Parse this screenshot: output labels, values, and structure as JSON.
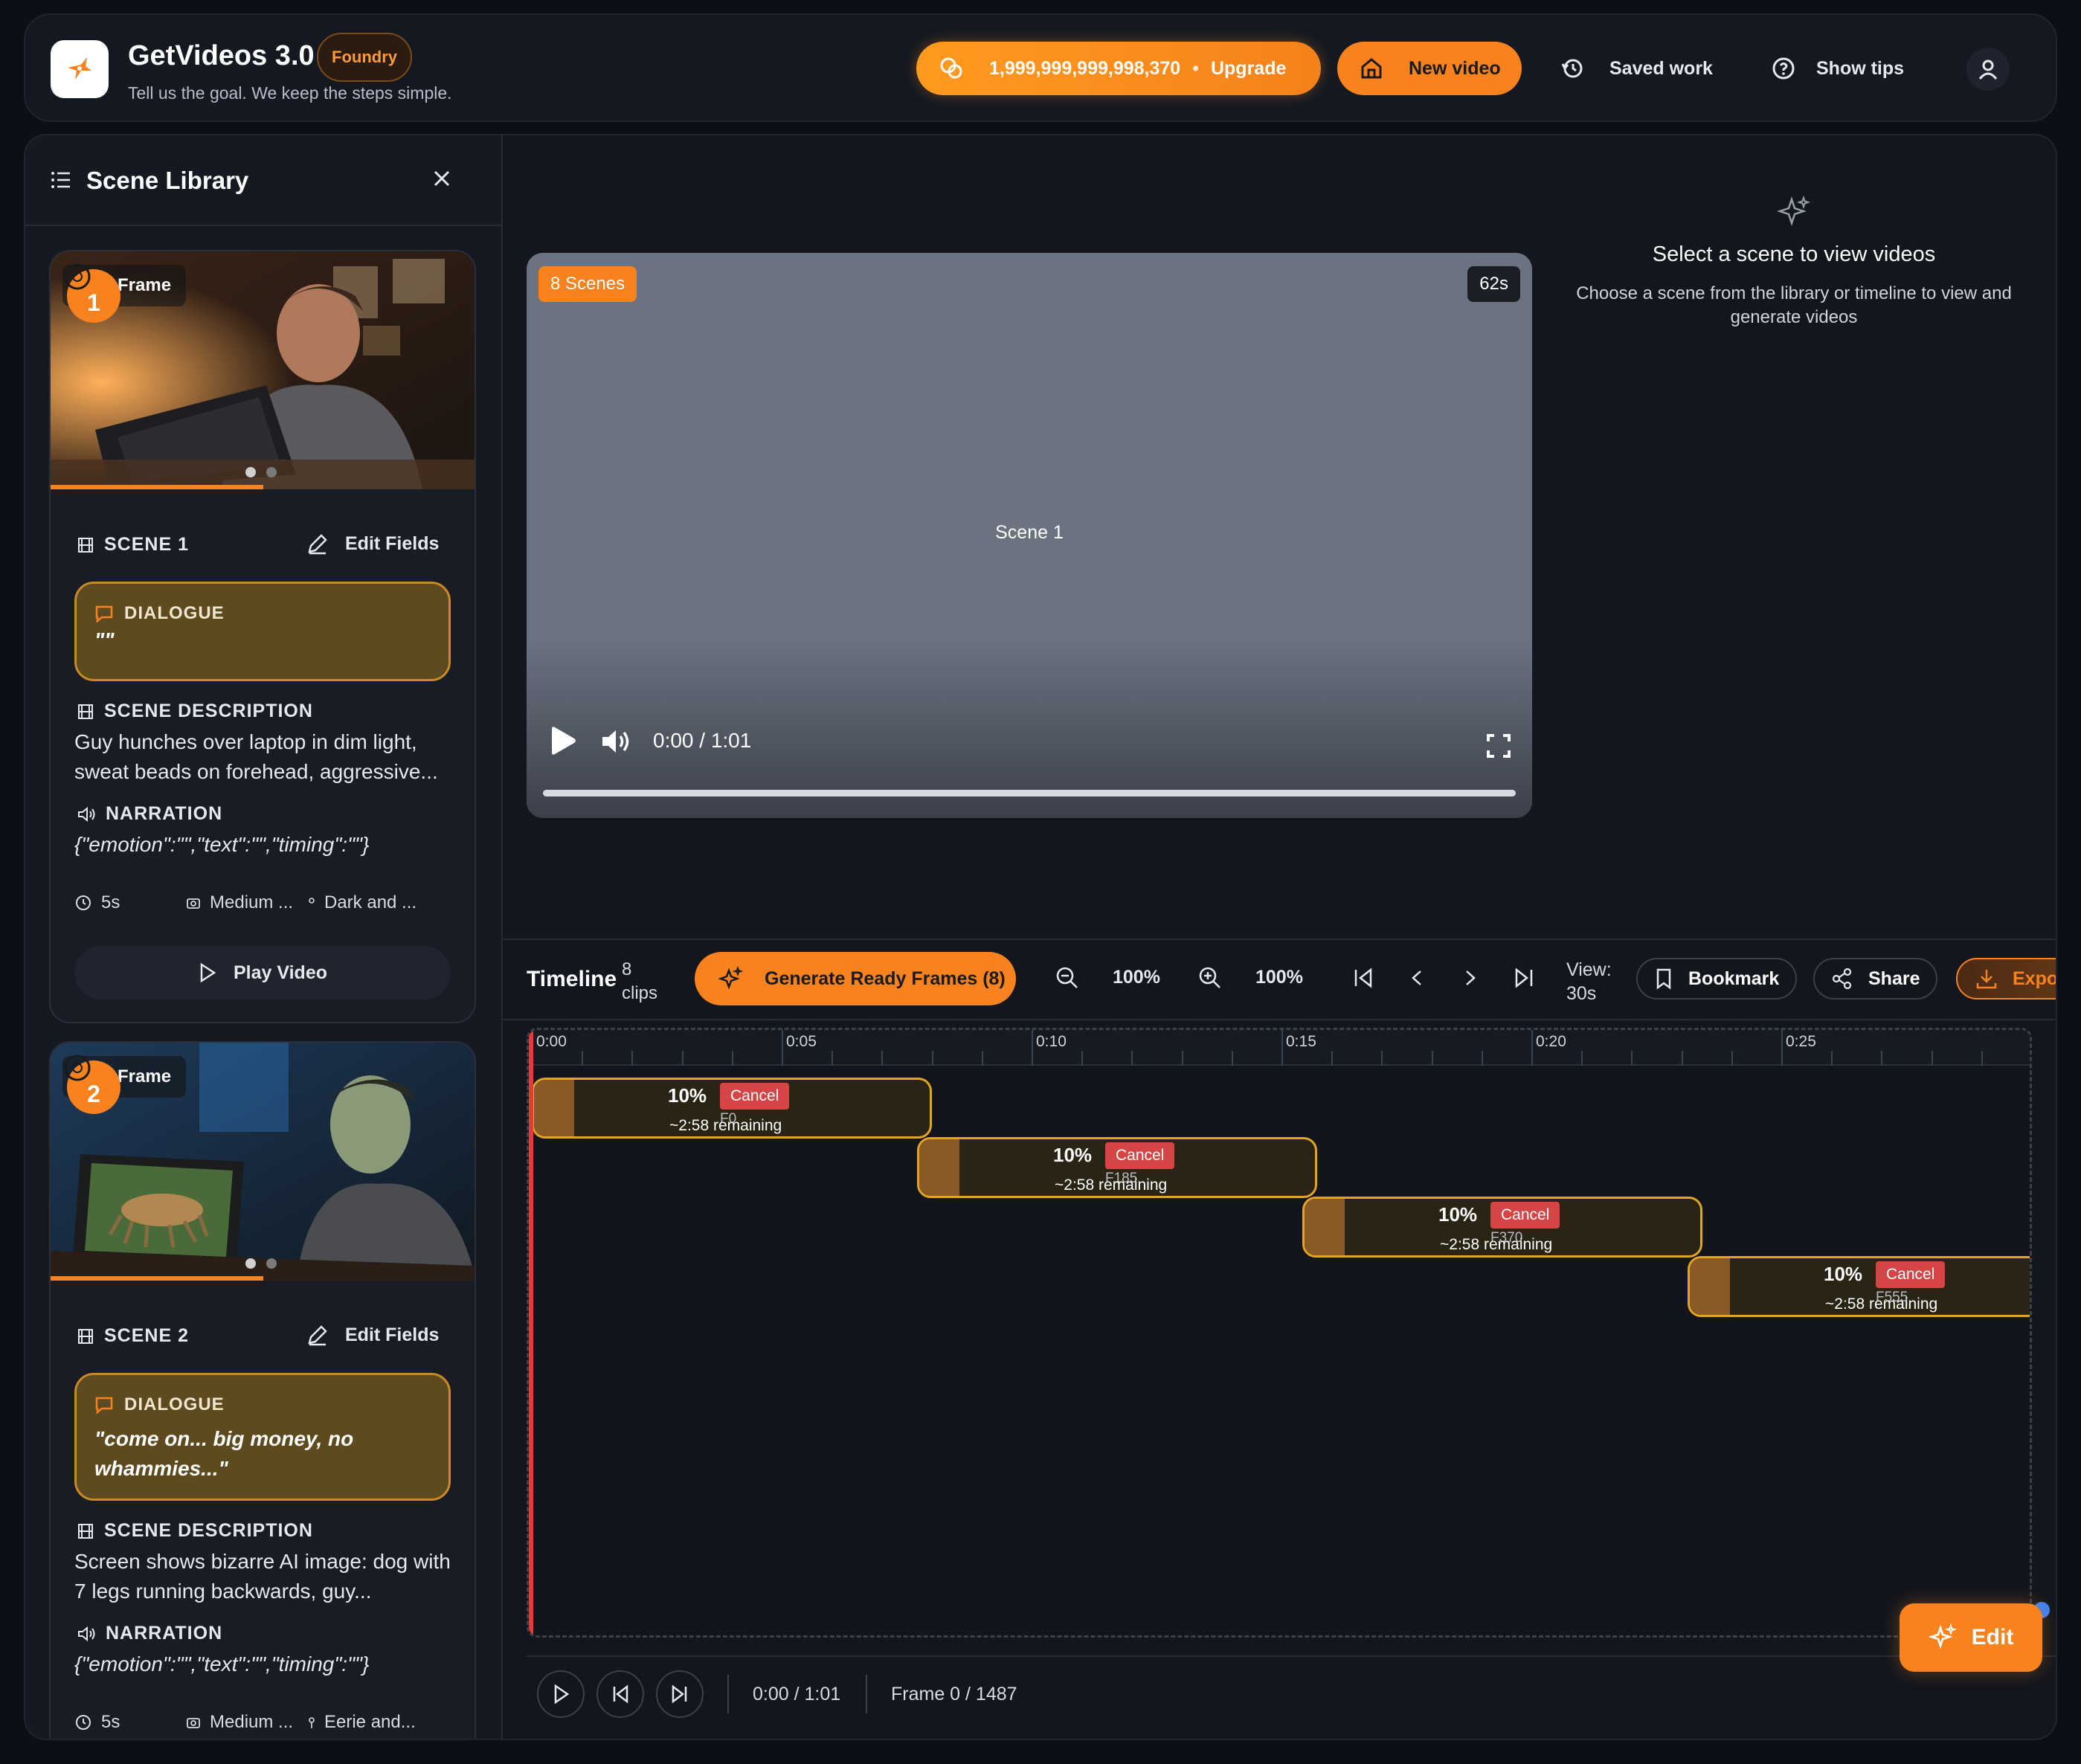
{
  "header": {
    "app_title": "GetVideos 3.0",
    "badge": "Foundry",
    "subtitle": "Tell us the goal. We keep the steps simple.",
    "credits": "1,999,999,999,998,370",
    "credits_sep": "•",
    "upgrade_label": "Upgrade",
    "new_video_label": "New video",
    "saved_work_label": "Saved work",
    "show_tips_label": "Show tips",
    "accent_color": "#f7821e"
  },
  "sidebar": {
    "title": "Scene Library",
    "cards": [
      {
        "frame_label": "Frame",
        "number": "1",
        "scene_label": "SCENE 1",
        "edit_label": "Edit Fields",
        "dialogue_heading": "DIALOGUE",
        "dialogue_text": "\"\"",
        "description_heading": "SCENE DESCRIPTION",
        "description": "Guy hunches over laptop in dim light, sweat beads on forehead, aggressive...",
        "narration_heading": "NARRATION",
        "narration": "{\"emotion\":\"\",\"text\":\"\",\"timing\":\"\"}",
        "duration": "5s",
        "shot": "Medium ...",
        "mood": "Dark and ...",
        "play_label": "Play Video"
      },
      {
        "frame_label": "Frame",
        "number": "2",
        "scene_label": "SCENE 2",
        "edit_label": "Edit Fields",
        "dialogue_heading": "DIALOGUE",
        "dialogue_text": "\"come on... big money, no whammies...\"",
        "description_heading": "SCENE DESCRIPTION",
        "description": "Screen shows bizarre AI image: dog with 7 legs running backwards, guy...",
        "narration_heading": "NARRATION",
        "narration": "{\"emotion\":\"\",\"text\":\"\",\"timing\":\"\"}",
        "duration": "5s",
        "shot": "Medium ...",
        "mood": "Eerie and..."
      }
    ]
  },
  "player": {
    "scenes_badge": "8 Scenes",
    "duration_badge": "62s",
    "scene_label": "Scene 1",
    "time": "0:00 / 1:01",
    "progress": 0
  },
  "info": {
    "title": "Select a scene to view videos",
    "subtitle": "Choose a scene from the library or timeline to view and generate videos"
  },
  "timeline": {
    "title": "Timeline",
    "clips_count": "8",
    "clips_label": "clips",
    "generate_label": "Generate Ready Frames (8)",
    "zoom_out_value": "100%",
    "zoom_in_value": "100%",
    "view_label": "View:",
    "view_value": "30s",
    "bookmark_label": "Bookmark",
    "share_label": "Share",
    "export_label": "Export",
    "ruler": [
      "0:00",
      "0:05",
      "0:10",
      "0:15",
      "0:20",
      "0:25"
    ],
    "clips": [
      {
        "id": "S1",
        "percent": "10%",
        "cancel": "Cancel",
        "remaining": "~2:58 remaining",
        "frame": "F0"
      },
      {
        "id": "S2",
        "percent": "10%",
        "cancel": "Cancel",
        "remaining": "~2:58 remaining",
        "frame": "F185"
      },
      {
        "id": "S3",
        "percent": "10%",
        "cancel": "Cancel",
        "remaining": "~2:58 remaining",
        "frame": "F370"
      },
      {
        "id": "S4",
        "percent": "10%",
        "cancel": "Cancel",
        "remaining": "~2:58 remaining",
        "frame": "F555"
      }
    ],
    "footer_time": "0:00 / 1:01",
    "footer_frame": "Frame 0 / 1487"
  },
  "fab": {
    "edit_label": "Edit"
  }
}
